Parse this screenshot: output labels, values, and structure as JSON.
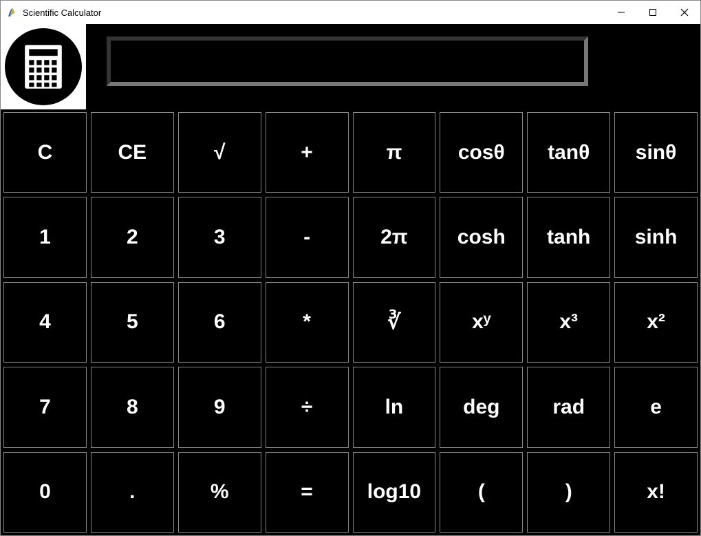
{
  "window": {
    "title": "Scientific Calculator"
  },
  "display": {
    "value": ""
  },
  "keys": {
    "r0": {
      "c0": "C",
      "c1": "CE",
      "c2": "√",
      "c3": "+",
      "c4": "π",
      "c5": "cosθ",
      "c6": "tanθ",
      "c7": "sinθ"
    },
    "r1": {
      "c0": "1",
      "c1": "2",
      "c2": "3",
      "c3": "-",
      "c4": "2π",
      "c5": "cosh",
      "c6": "tanh",
      "c7": "sinh"
    },
    "r2": {
      "c0": "4",
      "c1": "5",
      "c2": "6",
      "c3": "*",
      "c4": "∛",
      "c5": "xʸ",
      "c6": "x³",
      "c7": "x²"
    },
    "r3": {
      "c0": "7",
      "c1": "8",
      "c2": "9",
      "c3": "÷",
      "c4": "ln",
      "c5": "deg",
      "c6": "rad",
      "c7": "e"
    },
    "r4": {
      "c0": "0",
      "c1": ".",
      "c2": "%",
      "c3": "=",
      "c4": "log10",
      "c5": "(",
      "c6": ")",
      "c7": "x!"
    }
  },
  "key_names": {
    "r0": {
      "c0": "clear",
      "c1": "clear-entry",
      "c2": "sqrt",
      "c3": "plus",
      "c4": "pi",
      "c5": "cos",
      "c6": "tan",
      "c7": "sin"
    },
    "r1": {
      "c0": "digit-1",
      "c1": "digit-2",
      "c2": "digit-3",
      "c3": "minus",
      "c4": "two-pi",
      "c5": "cosh",
      "c6": "tanh",
      "c7": "sinh"
    },
    "r2": {
      "c0": "digit-4",
      "c1": "digit-5",
      "c2": "digit-6",
      "c3": "multiply",
      "c4": "cbrt",
      "c5": "x-pow-y",
      "c6": "x-cubed",
      "c7": "x-squared"
    },
    "r3": {
      "c0": "digit-7",
      "c1": "digit-8",
      "c2": "digit-9",
      "c3": "divide",
      "c4": "ln",
      "c5": "deg",
      "c6": "rad",
      "c7": "euler-e"
    },
    "r4": {
      "c0": "digit-0",
      "c1": "decimal",
      "c2": "percent",
      "c3": "equals",
      "c4": "log10",
      "c5": "lparen",
      "c6": "rparen",
      "c7": "factorial"
    }
  }
}
